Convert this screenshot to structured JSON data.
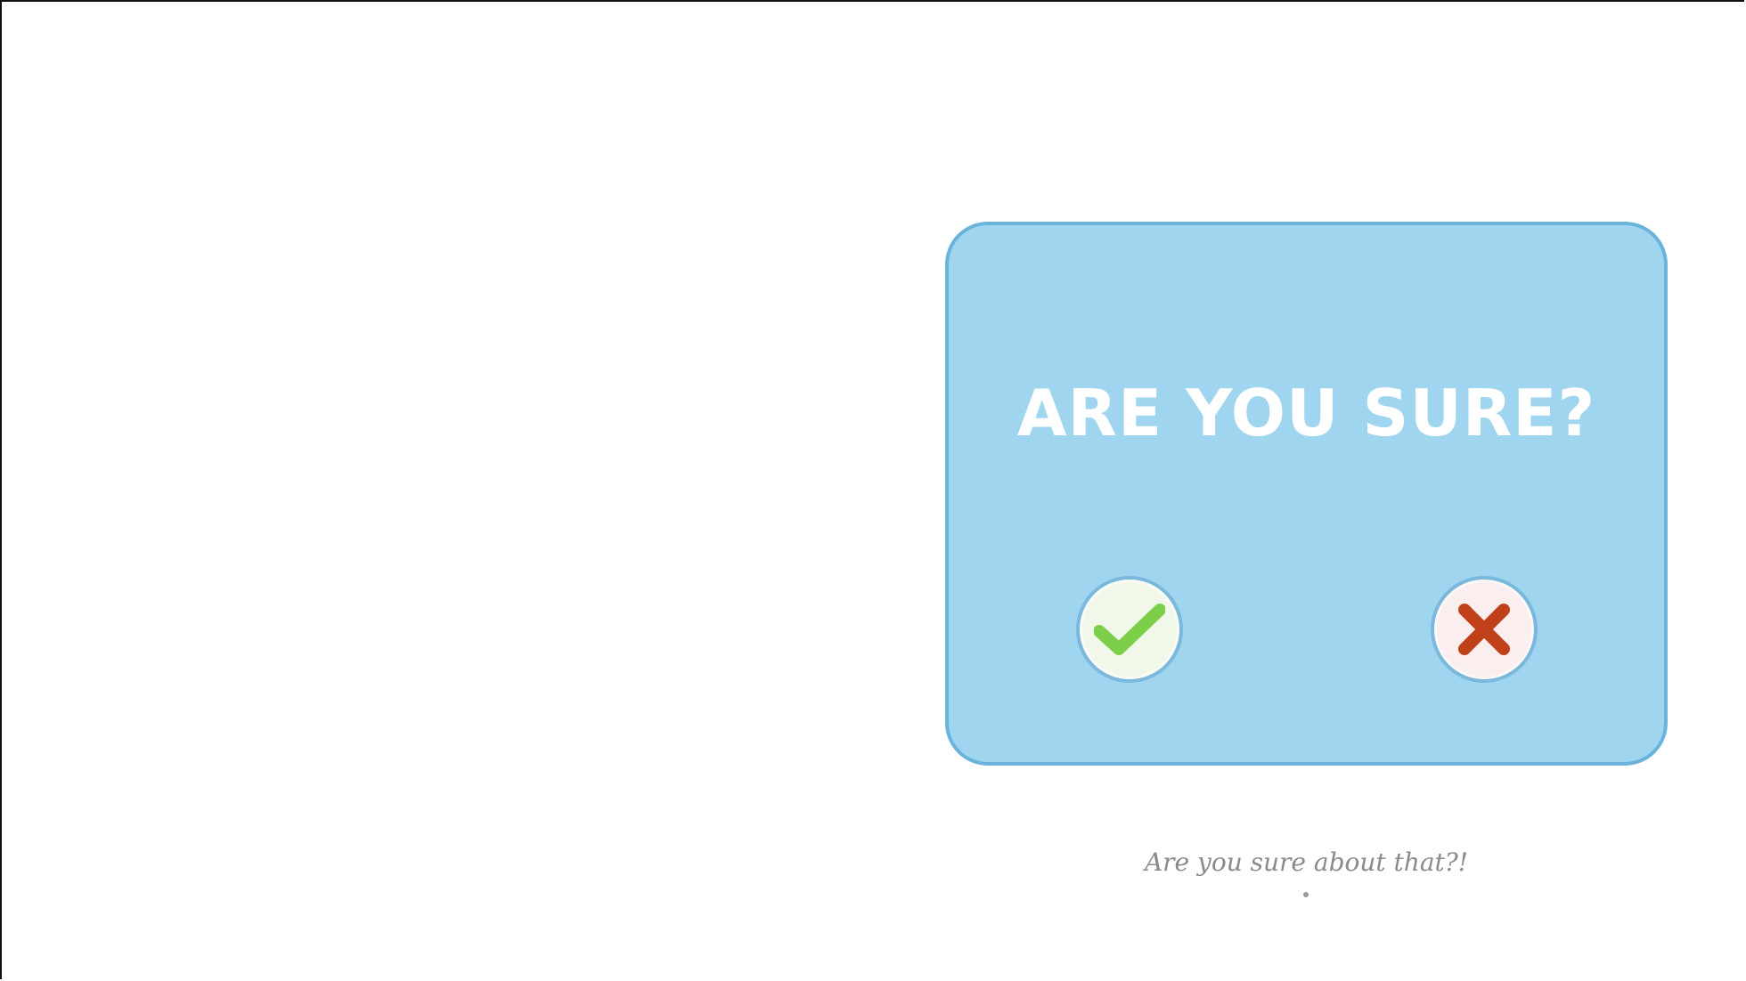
{
  "dialog": {
    "title": "ARE YOU SURE?",
    "confirm_icon": "check-icon",
    "cancel_icon": "x-icon"
  },
  "caption": "Are you sure about that?!",
  "colors": {
    "dialog_background": "#9fd5ef",
    "dialog_border": "#6ab4dc",
    "check": "#7dcf4a",
    "cross": "#c0401a"
  }
}
